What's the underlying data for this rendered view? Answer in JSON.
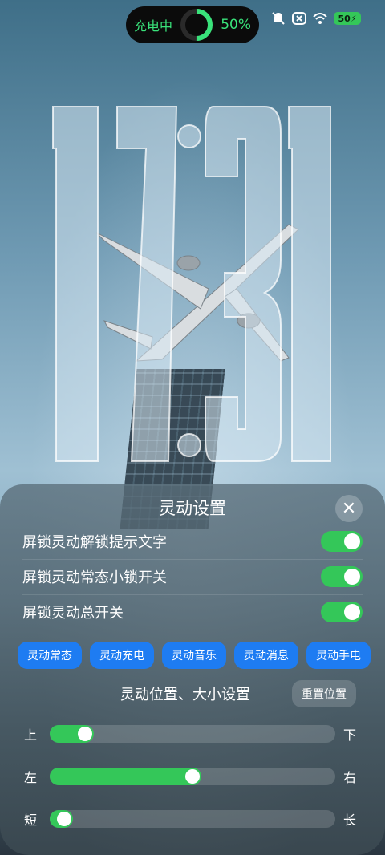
{
  "status_bar": {
    "island_label": "充电中",
    "charge_percent": "50%",
    "battery_level": "50",
    "icons": [
      "mute-icon",
      "x-box-icon",
      "wifi-icon",
      "battery-icon"
    ],
    "accent_color": "#39e27a"
  },
  "lockscreen": {
    "clock_text": "17:31"
  },
  "panel": {
    "title": "灵动设置",
    "close_label": "✕",
    "toggles": [
      {
        "label": "屏锁灵动解锁提示文字",
        "on": true
      },
      {
        "label": "屏锁灵动常态小锁开关",
        "on": true
      },
      {
        "label": "屏锁灵动总开关",
        "on": true
      }
    ],
    "tabs": [
      "灵动常态",
      "灵动充电",
      "灵动音乐",
      "灵动消息",
      "灵动手电"
    ],
    "position_title": "灵动位置、大小设置",
    "reset_label": "重置位置",
    "sliders": [
      {
        "left_label": "上",
        "right_label": "下",
        "value": 0.1
      },
      {
        "left_label": "左",
        "right_label": "右",
        "value": 0.5
      },
      {
        "left_label": "短",
        "right_label": "长",
        "value": 0.02
      }
    ],
    "colors": {
      "toggle_on": "#34c759",
      "tab_blue": "#1e7cf2"
    }
  }
}
